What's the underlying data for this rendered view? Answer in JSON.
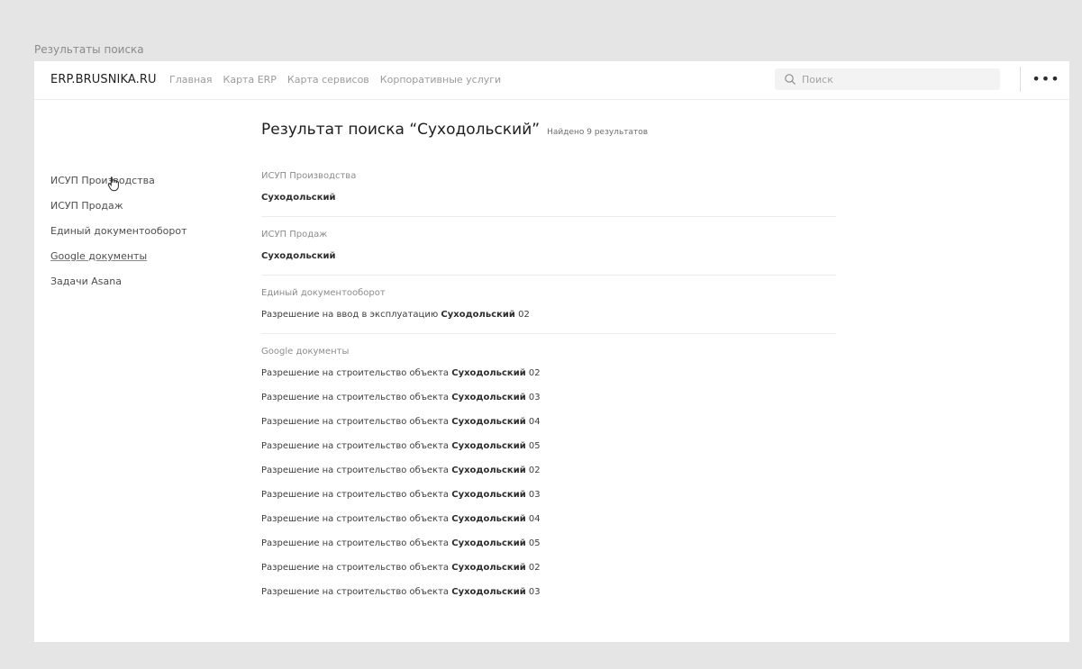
{
  "page_label": "Результаты поиска",
  "header": {
    "brand": "ERP.BRUSNIKA.RU",
    "nav": [
      "Главная",
      "Карта ERP",
      "Карта сервисов",
      "Корпоративные услуги"
    ],
    "search_placeholder": "Поиск",
    "more_label": "•••"
  },
  "sidebar": {
    "items": [
      "ИСУП Производства",
      "ИСУП Продаж",
      "Единый документооборот",
      "Google документы",
      "Задачи Asana"
    ]
  },
  "main": {
    "title": "Результат поиска “Суходольский”",
    "found": "Найдено 9 результатов",
    "groups": [
      {
        "title": "ИСУП Производства",
        "results": [
          {
            "prefix": "",
            "highlight": "Суходольский",
            "suffix": ""
          }
        ]
      },
      {
        "title": "ИСУП Продаж",
        "results": [
          {
            "prefix": "",
            "highlight": "Суходольский",
            "suffix": ""
          }
        ]
      },
      {
        "title": "Единый документооборот",
        "results": [
          {
            "prefix": "Разрешение на ввод в эксплуатацию ",
            "highlight": "Суходольский",
            "suffix": " 02"
          }
        ]
      },
      {
        "title": "Google документы",
        "results": [
          {
            "prefix": "Разрешение на строительство объекта ",
            "highlight": "Суходольский",
            "suffix": " 02"
          },
          {
            "prefix": "Разрешение на строительство объекта ",
            "highlight": "Суходольский",
            "suffix": " 03"
          },
          {
            "prefix": "Разрешение на строительство объекта ",
            "highlight": "Суходольский",
            "suffix": " 04"
          },
          {
            "prefix": "Разрешение на строительство объекта ",
            "highlight": "Суходольский",
            "suffix": " 05"
          },
          {
            "prefix": "Разрешение на строительство объекта ",
            "highlight": "Суходольский",
            "suffix": " 02"
          },
          {
            "prefix": "Разрешение на строительство объекта ",
            "highlight": "Суходольский",
            "suffix": " 03"
          },
          {
            "prefix": "Разрешение на строительство объекта ",
            "highlight": "Суходольский",
            "suffix": " 04"
          },
          {
            "prefix": "Разрешение на строительство объекта ",
            "highlight": "Суходольский",
            "suffix": " 05"
          },
          {
            "prefix": "Разрешение на строительство объекта ",
            "highlight": "Суходольский",
            "suffix": " 02"
          },
          {
            "prefix": "Разрешение на строительство объекта ",
            "highlight": "Суходольский",
            "suffix": " 03"
          }
        ]
      }
    ]
  }
}
